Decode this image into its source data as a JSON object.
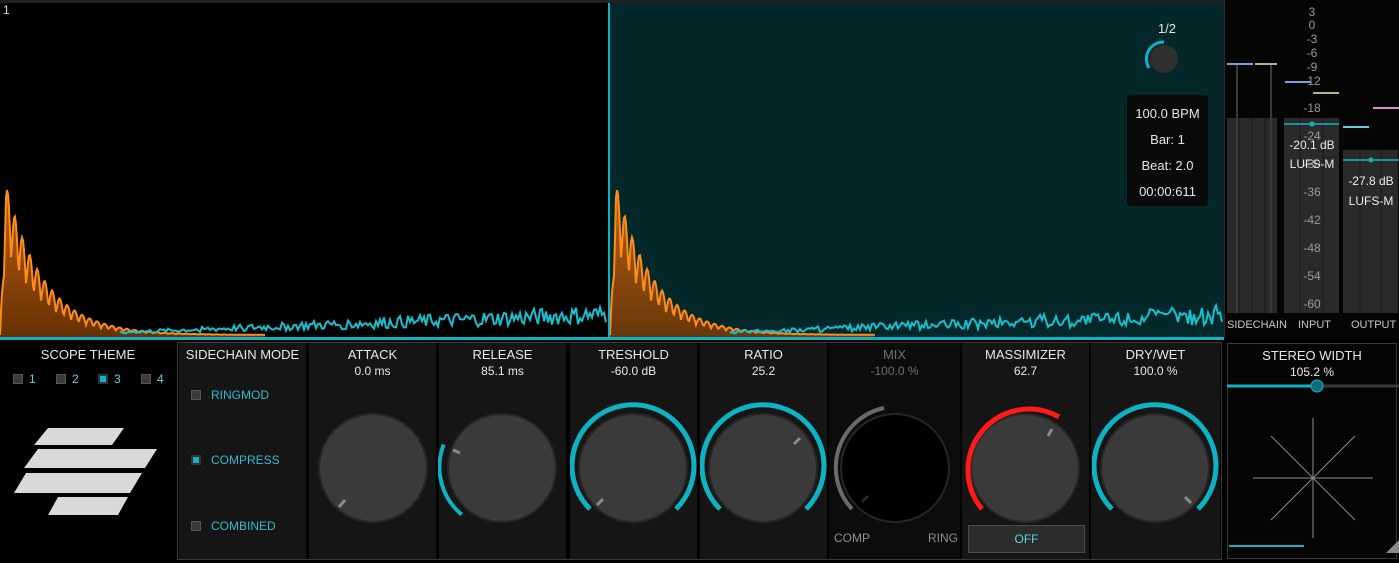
{
  "scope": {
    "page_number": "1",
    "division": "1/2",
    "transport": {
      "bpm": "100.0 BPM",
      "bar": "Bar: 1",
      "beat": "Beat: 2.0",
      "time": "00:00:611"
    }
  },
  "meters": {
    "ticks": [
      "3",
      "0",
      "-3",
      "-6",
      "-9",
      "-12",
      "-18",
      "-24",
      "-30",
      "-36",
      "-42",
      "-48",
      "-54",
      "-60"
    ],
    "input_value": "-20.1 dB",
    "input_unit": "LUFS-M",
    "output_value": "-27.8 dB",
    "output_unit": "LUFS-M",
    "captions": [
      "SIDECHAIN",
      "INPUT",
      "OUTPUT"
    ]
  },
  "scope_theme": {
    "title": "SCOPE THEME",
    "options": [
      "1",
      "2",
      "3",
      "4"
    ],
    "selected": "3"
  },
  "sidechain_mode": {
    "title": "SIDECHAIN MODE",
    "options": [
      "RINGMOD",
      "COMPRESS",
      "COMBINED"
    ],
    "selected": "COMPRESS"
  },
  "knobs": {
    "attack": {
      "title": "ATTACK",
      "value": "0.0 ms"
    },
    "release": {
      "title": "RELEASE",
      "value": "85.1 ms"
    },
    "threshold": {
      "title": "TRESHOLD",
      "value": "-60.0 dB"
    },
    "ratio": {
      "title": "RATIO",
      "value": "25.2"
    },
    "mix": {
      "title": "MIX",
      "value": "-100.0 %",
      "left_label": "COMP",
      "right_label": "RING"
    },
    "massimizer": {
      "title": "MASSIMIZER",
      "value": "62.7",
      "button_label": "OFF"
    },
    "drywet": {
      "title": "DRY/WET",
      "value": "100.0 %"
    }
  },
  "stereo_width": {
    "title": "STEREO WIDTH",
    "value": "105.2 %"
  },
  "colors": {
    "accent": "#0fb2c2",
    "waveform_orange": "#ff8c1a",
    "massimizer_red": "#ff1a1a",
    "scope_bg": "#042829"
  }
}
